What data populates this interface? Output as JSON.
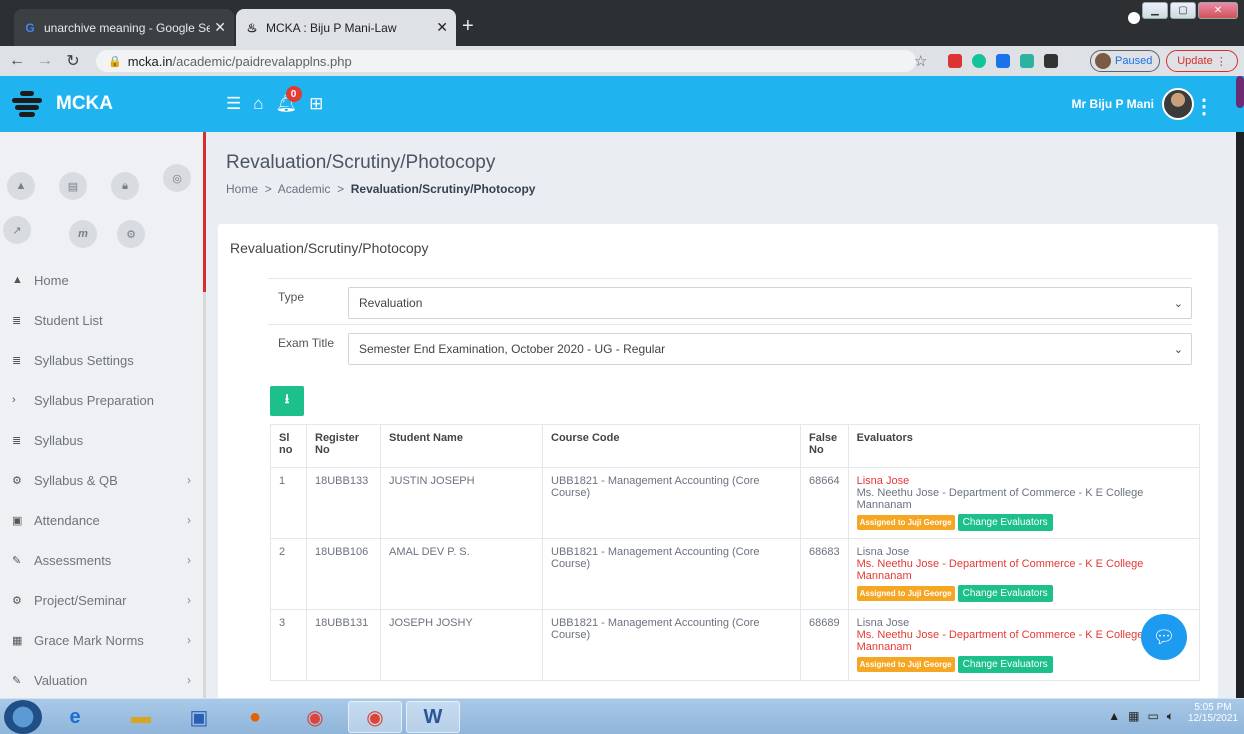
{
  "browser": {
    "tabs": [
      {
        "icon": "G",
        "title": "unarchive meaning - Google Sea",
        "close": "✕"
      },
      {
        "icon": "♨",
        "title": "MCKA : Biju P Mani-Law",
        "close": "✕"
      }
    ],
    "new_tab": "+",
    "url_host": "mcka.in",
    "url_path": "/academic/paidrevalapplns.php",
    "paused_label": "Paused",
    "update_label": "Update"
  },
  "app": {
    "brand": "MCKA",
    "notification_count": "0",
    "user_name": "Mr Biju P Mani"
  },
  "sidebar": {
    "items": [
      {
        "label": "Home",
        "icon": "▲",
        "chevron": ""
      },
      {
        "label": "Student List",
        "icon": "≣",
        "chevron": ""
      },
      {
        "label": "Syllabus Settings",
        "icon": "≣",
        "chevron": ""
      },
      {
        "label": "Syllabus Preparation",
        "icon": "›",
        "chevron": ""
      },
      {
        "label": "Syllabus",
        "icon": "≣",
        "chevron": ""
      },
      {
        "label": "Syllabus & QB",
        "icon": "⚙",
        "chevron": "›"
      },
      {
        "label": "Attendance",
        "icon": "▣",
        "chevron": "›"
      },
      {
        "label": "Assessments",
        "icon": "✎",
        "chevron": "›"
      },
      {
        "label": "Project/Seminar",
        "icon": "⚙",
        "chevron": "›"
      },
      {
        "label": "Grace Mark Norms",
        "icon": "▦",
        "chevron": "›"
      },
      {
        "label": "Valuation",
        "icon": "✎",
        "chevron": "›"
      }
    ]
  },
  "page": {
    "title": "Revaluation/Scrutiny/Photocopy",
    "breadcrumb": [
      "Home",
      "Academic",
      "Revaluation/Scrutiny/Photocopy"
    ],
    "breadcrumb_sep": ">",
    "card_title": "Revaluation/Scrutiny/Photocopy",
    "type_label": "Type",
    "type_value": "Revaluation",
    "exam_label": "Exam Title",
    "exam_value": "Semester End Examination, October 2020 - UG - Regular"
  },
  "table": {
    "headers": {
      "sl": "Sl no",
      "reg": "Register No",
      "name": "Student Name",
      "course": "Course Code",
      "false": "False No",
      "eval": "Evaluators"
    },
    "rows": [
      {
        "sl": "1",
        "reg": "18UBB133",
        "name": "JUSTIN JOSEPH",
        "course": "UBB1821 - Management Accounting (Core Course)",
        "false": "68664",
        "ev1": "Lisna Jose",
        "ev2": "Ms. Neethu Jose - Department of Commerce - K E College Mannanam",
        "badge": "Assigned to Juji George",
        "btn": "Change Evaluators"
      },
      {
        "sl": "2",
        "reg": "18UBB106",
        "name": "AMAL DEV P. S.",
        "course": "UBB1821 - Management Accounting (Core Course)",
        "false": "68683",
        "ev1": "Lisna Jose",
        "ev2": "Ms. Neethu Jose - Department of Commerce - K E College Mannanam",
        "badge": "Assigned to Juji George",
        "btn": "Change Evaluators"
      },
      {
        "sl": "3",
        "reg": "18UBB131",
        "name": "JOSEPH JOSHY",
        "course": "UBB1821 - Management Accounting (Core Course)",
        "false": "68689",
        "ev1": "Lisna Jose",
        "ev2": "Ms. Neethu Jose - Department of Commerce - K E College Mannanam",
        "badge": "Assigned to Juji George",
        "btn": "Change Evaluators"
      }
    ]
  },
  "taskbar": {
    "time": "5:05 PM",
    "date": "12/15/2021"
  },
  "colors": {
    "header": "#1fb3f0",
    "accent_green": "#1dbf8a",
    "badge_orange": "#f5a623",
    "evaluator_red": "#e53935"
  }
}
